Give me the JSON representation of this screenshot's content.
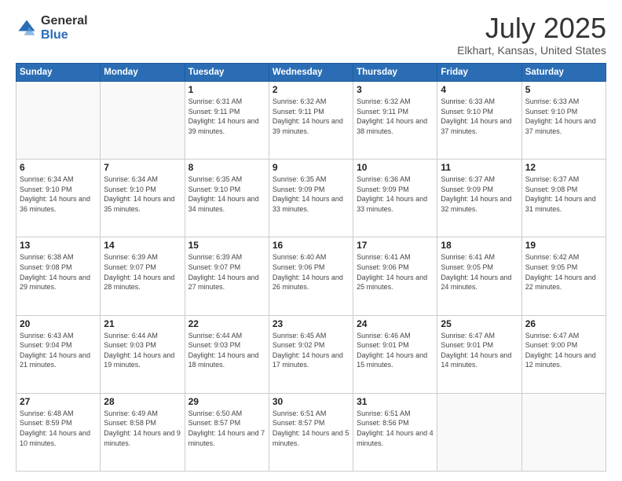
{
  "logo": {
    "general": "General",
    "blue": "Blue"
  },
  "title": "July 2025",
  "subtitle": "Elkhart, Kansas, United States",
  "headers": [
    "Sunday",
    "Monday",
    "Tuesday",
    "Wednesday",
    "Thursday",
    "Friday",
    "Saturday"
  ],
  "weeks": [
    [
      {
        "num": "",
        "sunrise": "",
        "sunset": "",
        "daylight": ""
      },
      {
        "num": "",
        "sunrise": "",
        "sunset": "",
        "daylight": ""
      },
      {
        "num": "1",
        "sunrise": "Sunrise: 6:31 AM",
        "sunset": "Sunset: 9:11 PM",
        "daylight": "Daylight: 14 hours and 39 minutes."
      },
      {
        "num": "2",
        "sunrise": "Sunrise: 6:32 AM",
        "sunset": "Sunset: 9:11 PM",
        "daylight": "Daylight: 14 hours and 39 minutes."
      },
      {
        "num": "3",
        "sunrise": "Sunrise: 6:32 AM",
        "sunset": "Sunset: 9:11 PM",
        "daylight": "Daylight: 14 hours and 38 minutes."
      },
      {
        "num": "4",
        "sunrise": "Sunrise: 6:33 AM",
        "sunset": "Sunset: 9:10 PM",
        "daylight": "Daylight: 14 hours and 37 minutes."
      },
      {
        "num": "5",
        "sunrise": "Sunrise: 6:33 AM",
        "sunset": "Sunset: 9:10 PM",
        "daylight": "Daylight: 14 hours and 37 minutes."
      }
    ],
    [
      {
        "num": "6",
        "sunrise": "Sunrise: 6:34 AM",
        "sunset": "Sunset: 9:10 PM",
        "daylight": "Daylight: 14 hours and 36 minutes."
      },
      {
        "num": "7",
        "sunrise": "Sunrise: 6:34 AM",
        "sunset": "Sunset: 9:10 PM",
        "daylight": "Daylight: 14 hours and 35 minutes."
      },
      {
        "num": "8",
        "sunrise": "Sunrise: 6:35 AM",
        "sunset": "Sunset: 9:10 PM",
        "daylight": "Daylight: 14 hours and 34 minutes."
      },
      {
        "num": "9",
        "sunrise": "Sunrise: 6:35 AM",
        "sunset": "Sunset: 9:09 PM",
        "daylight": "Daylight: 14 hours and 33 minutes."
      },
      {
        "num": "10",
        "sunrise": "Sunrise: 6:36 AM",
        "sunset": "Sunset: 9:09 PM",
        "daylight": "Daylight: 14 hours and 33 minutes."
      },
      {
        "num": "11",
        "sunrise": "Sunrise: 6:37 AM",
        "sunset": "Sunset: 9:09 PM",
        "daylight": "Daylight: 14 hours and 32 minutes."
      },
      {
        "num": "12",
        "sunrise": "Sunrise: 6:37 AM",
        "sunset": "Sunset: 9:08 PM",
        "daylight": "Daylight: 14 hours and 31 minutes."
      }
    ],
    [
      {
        "num": "13",
        "sunrise": "Sunrise: 6:38 AM",
        "sunset": "Sunset: 9:08 PM",
        "daylight": "Daylight: 14 hours and 29 minutes."
      },
      {
        "num": "14",
        "sunrise": "Sunrise: 6:39 AM",
        "sunset": "Sunset: 9:07 PM",
        "daylight": "Daylight: 14 hours and 28 minutes."
      },
      {
        "num": "15",
        "sunrise": "Sunrise: 6:39 AM",
        "sunset": "Sunset: 9:07 PM",
        "daylight": "Daylight: 14 hours and 27 minutes."
      },
      {
        "num": "16",
        "sunrise": "Sunrise: 6:40 AM",
        "sunset": "Sunset: 9:06 PM",
        "daylight": "Daylight: 14 hours and 26 minutes."
      },
      {
        "num": "17",
        "sunrise": "Sunrise: 6:41 AM",
        "sunset": "Sunset: 9:06 PM",
        "daylight": "Daylight: 14 hours and 25 minutes."
      },
      {
        "num": "18",
        "sunrise": "Sunrise: 6:41 AM",
        "sunset": "Sunset: 9:05 PM",
        "daylight": "Daylight: 14 hours and 24 minutes."
      },
      {
        "num": "19",
        "sunrise": "Sunrise: 6:42 AM",
        "sunset": "Sunset: 9:05 PM",
        "daylight": "Daylight: 14 hours and 22 minutes."
      }
    ],
    [
      {
        "num": "20",
        "sunrise": "Sunrise: 6:43 AM",
        "sunset": "Sunset: 9:04 PM",
        "daylight": "Daylight: 14 hours and 21 minutes."
      },
      {
        "num": "21",
        "sunrise": "Sunrise: 6:44 AM",
        "sunset": "Sunset: 9:03 PM",
        "daylight": "Daylight: 14 hours and 19 minutes."
      },
      {
        "num": "22",
        "sunrise": "Sunrise: 6:44 AM",
        "sunset": "Sunset: 9:03 PM",
        "daylight": "Daylight: 14 hours and 18 minutes."
      },
      {
        "num": "23",
        "sunrise": "Sunrise: 6:45 AM",
        "sunset": "Sunset: 9:02 PM",
        "daylight": "Daylight: 14 hours and 17 minutes."
      },
      {
        "num": "24",
        "sunrise": "Sunrise: 6:46 AM",
        "sunset": "Sunset: 9:01 PM",
        "daylight": "Daylight: 14 hours and 15 minutes."
      },
      {
        "num": "25",
        "sunrise": "Sunrise: 6:47 AM",
        "sunset": "Sunset: 9:01 PM",
        "daylight": "Daylight: 14 hours and 14 minutes."
      },
      {
        "num": "26",
        "sunrise": "Sunrise: 6:47 AM",
        "sunset": "Sunset: 9:00 PM",
        "daylight": "Daylight: 14 hours and 12 minutes."
      }
    ],
    [
      {
        "num": "27",
        "sunrise": "Sunrise: 6:48 AM",
        "sunset": "Sunset: 8:59 PM",
        "daylight": "Daylight: 14 hours and 10 minutes."
      },
      {
        "num": "28",
        "sunrise": "Sunrise: 6:49 AM",
        "sunset": "Sunset: 8:58 PM",
        "daylight": "Daylight: 14 hours and 9 minutes."
      },
      {
        "num": "29",
        "sunrise": "Sunrise: 6:50 AM",
        "sunset": "Sunset: 8:57 PM",
        "daylight": "Daylight: 14 hours and 7 minutes."
      },
      {
        "num": "30",
        "sunrise": "Sunrise: 6:51 AM",
        "sunset": "Sunset: 8:57 PM",
        "daylight": "Daylight: 14 hours and 5 minutes."
      },
      {
        "num": "31",
        "sunrise": "Sunrise: 6:51 AM",
        "sunset": "Sunset: 8:56 PM",
        "daylight": "Daylight: 14 hours and 4 minutes."
      },
      {
        "num": "",
        "sunrise": "",
        "sunset": "",
        "daylight": ""
      },
      {
        "num": "",
        "sunrise": "",
        "sunset": "",
        "daylight": ""
      }
    ]
  ]
}
